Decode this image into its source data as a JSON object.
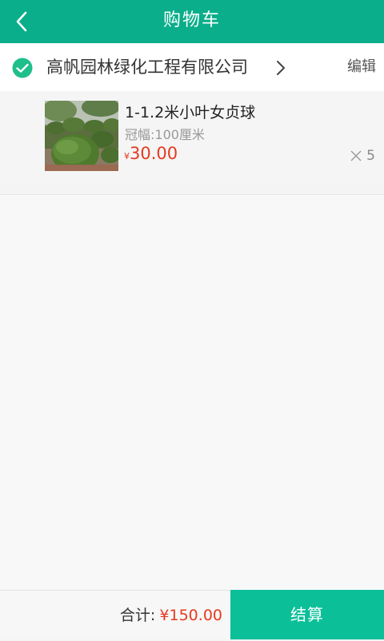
{
  "header": {
    "title": "购物车",
    "back_icon": "chevron-left-icon",
    "bg_color": "#0aae8a"
  },
  "shop": {
    "name": "高帆园林绿化工程有限公司",
    "selected": true,
    "check_icon": "check-circle-icon",
    "arrow_icon": "chevron-right-icon",
    "edit_label": "编辑"
  },
  "items": [
    {
      "title": "1-1.2米小叶女贞球",
      "spec": "冠幅:100厘米",
      "currency": "¥",
      "price": "30.00",
      "quantity": "5",
      "quantity_icon": "times-icon",
      "image": "shrub-photo"
    }
  ],
  "footer": {
    "total_label": "合计:",
    "total_value": "¥150.00",
    "checkout_label": "结算",
    "checkout_color": "#0bbf99",
    "price_color": "#e6391f"
  }
}
